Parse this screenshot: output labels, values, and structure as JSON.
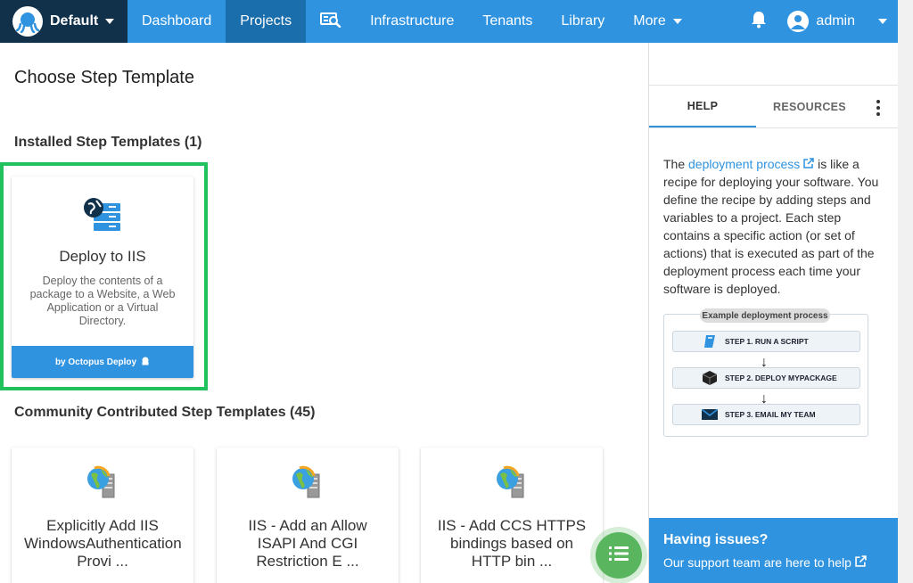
{
  "nav": {
    "space_name": "Default",
    "items": [
      "Dashboard",
      "Projects",
      "Infrastructure",
      "Tenants",
      "Library",
      "More"
    ],
    "user": "admin"
  },
  "page": {
    "title": "Choose Step Template",
    "installed_title": "Installed Step Templates (1)",
    "community_title": "Community Contributed Step Templates (45)"
  },
  "installed": [
    {
      "title": "Deploy to IIS",
      "description": "Deploy the contents of a package to a Website, a Web Application or a Virtual Directory.",
      "footer": "by Octopus Deploy"
    }
  ],
  "community": [
    {
      "title": "Explicitly Add IIS WindowsAuthentication Provi ..."
    },
    {
      "title": "IIS - Add an Allow ISAPI And CGI Restriction E ..."
    },
    {
      "title": "IIS - Add CCS HTTPS bindings based on HTTP bin ..."
    }
  ],
  "help": {
    "tabs": [
      "HELP",
      "RESOURCES"
    ],
    "intro_before": "The ",
    "intro_link": "deployment process",
    "intro_after": " is like a recipe for deploying your software. You define the recipe by adding steps and variables to a project. Each step contains a specific action (or set of actions) that is executed as part of the deployment process each time your software is deployed.",
    "diagram_title": "Example deployment process",
    "steps": [
      "STEP 1. RUN A SCRIPT",
      "STEP 2. DEPLOY MYPACKAGE",
      "STEP 3. EMAIL MY TEAM"
    ],
    "issues_title": "Having issues?",
    "issues_text": "Our support team are here to help"
  },
  "colors": {
    "nav_blue": "#2f93e0",
    "nav_dark": "#11314b",
    "active_nav": "#1a6eab",
    "highlight_green": "#21c25e",
    "fab_green": "#5ab65e"
  },
  "icons": {
    "space": "octopus-logo-icon",
    "nav_search": "search-machine-icon",
    "bell": "bell-icon",
    "user": "user-avatar-icon",
    "template": "globe-server-icon",
    "fab": "task-list-icon"
  }
}
